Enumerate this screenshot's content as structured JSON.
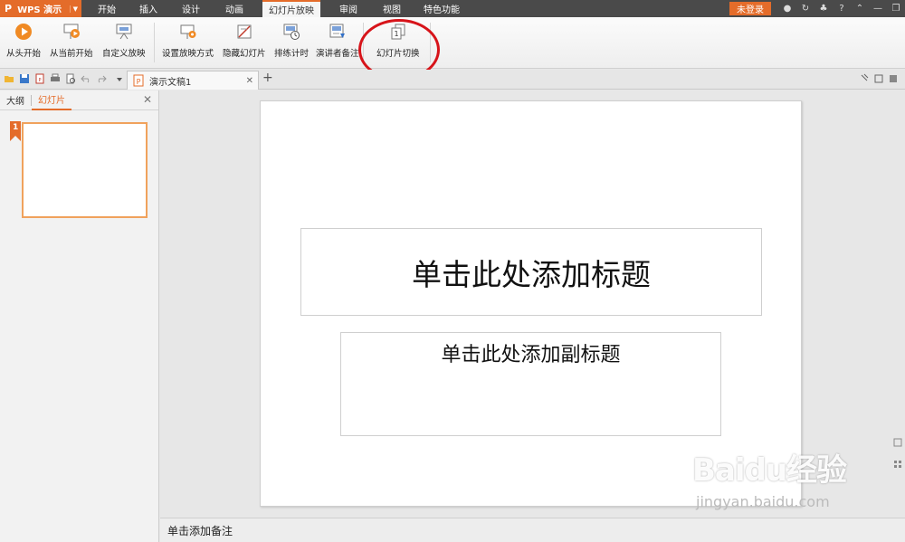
{
  "menubar": {
    "app_title": "WPS 演示",
    "tabs": [
      {
        "label": "开始",
        "active": false
      },
      {
        "label": "插入",
        "active": false
      },
      {
        "label": "设计",
        "active": false
      },
      {
        "label": "动画",
        "active": false
      },
      {
        "label": "幻灯片放映",
        "active": true
      },
      {
        "label": "审阅",
        "active": false
      },
      {
        "label": "视图",
        "active": false
      },
      {
        "label": "特色功能",
        "active": false
      }
    ],
    "login_label": "未登录"
  },
  "ribbon": {
    "buttons": [
      {
        "label": "从头开始",
        "icon": "play-icon"
      },
      {
        "label": "从当前开始",
        "icon": "play-current-icon"
      },
      {
        "label": "自定义放映",
        "icon": "custom-show-icon"
      },
      {
        "label": "设置放映方式",
        "icon": "setup-show-icon"
      },
      {
        "label": "隐藏幻灯片",
        "icon": "hide-slide-icon"
      },
      {
        "label": "排练计时",
        "icon": "rehearse-timing-icon"
      },
      {
        "label": "演讲者备注",
        "icon": "speaker-notes-icon"
      },
      {
        "label": "幻灯片切换",
        "icon": "slide-transition-icon"
      }
    ]
  },
  "doc_tab": {
    "name": "演示文稿1"
  },
  "left_panel": {
    "tabs": [
      {
        "label": "大纲",
        "active": false
      },
      {
        "label": "幻灯片",
        "active": true
      }
    ],
    "slide_number": "1"
  },
  "slide": {
    "title_placeholder": "单击此处添加标题",
    "subtitle_placeholder": "单击此处添加副标题"
  },
  "notes": {
    "placeholder": "单击添加备注"
  },
  "watermark": {
    "logo": "Baidu经验",
    "url": "jingyan.baidu.com"
  },
  "colors": {
    "accent": "#e46c2a",
    "menubar": "#4a4a4a",
    "annotation": "#d7141a"
  }
}
